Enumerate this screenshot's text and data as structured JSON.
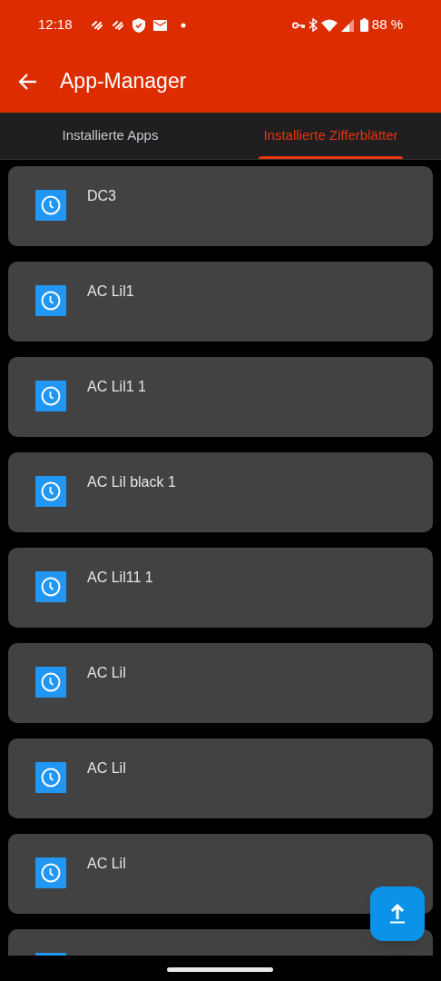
{
  "status_bar": {
    "time": "12:18",
    "battery": "88 %"
  },
  "app_bar": {
    "title": "App-Manager"
  },
  "tabs": [
    {
      "label": "Installierte Apps",
      "selected": false
    },
    {
      "label": "Installierte Zifferblätter",
      "selected": true
    }
  ],
  "watch_faces": [
    {
      "kind": "full",
      "name": "DC3"
    },
    {
      "kind": "full",
      "name": "AC Lil1"
    },
    {
      "kind": "full",
      "name": "AC Lil1 1"
    },
    {
      "kind": "full",
      "name": "AC Lil black 1"
    },
    {
      "kind": "full",
      "name": "AC Lil11 1"
    },
    {
      "kind": "full",
      "name": "AC Lil"
    },
    {
      "kind": "full",
      "name": "AC Lil"
    },
    {
      "kind": "full",
      "name": "AC Lil"
    },
    {
      "kind": "partial"
    }
  ]
}
